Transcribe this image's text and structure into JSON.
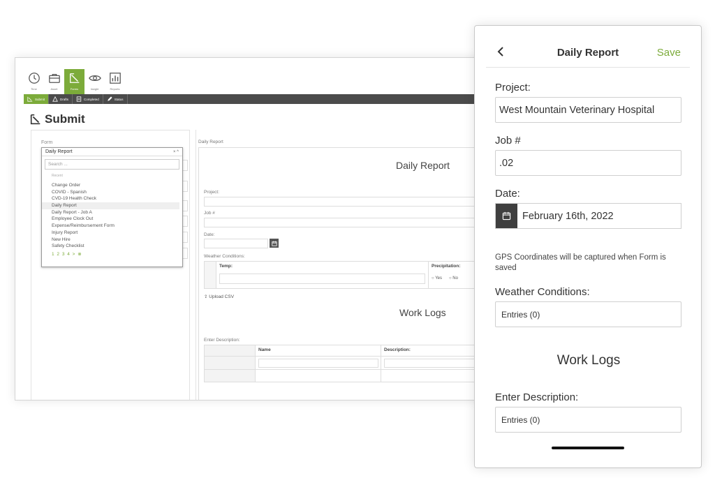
{
  "desktop": {
    "toolbar": [
      {
        "label": "Time",
        "icon": "clock-icon",
        "active": false
      },
      {
        "label": "Asset",
        "icon": "briefcase-icon",
        "active": false
      },
      {
        "label": "Forms",
        "icon": "form-icon",
        "active": true
      },
      {
        "label": "Insight",
        "icon": "eye-icon",
        "active": false
      },
      {
        "label": "Reports",
        "icon": "report-icon",
        "active": false
      }
    ],
    "subtabs": [
      {
        "label": "Submit",
        "icon": "submit-icon",
        "active": true
      },
      {
        "label": "Drafts",
        "icon": "warning-icon",
        "active": false
      },
      {
        "label": "Completed",
        "icon": "list-icon",
        "active": false
      },
      {
        "label": "Status",
        "icon": "pen-icon",
        "active": false
      }
    ],
    "page_title": "Submit",
    "form_label": "Form",
    "dropdown": {
      "selected": "Daily Report",
      "controls": "× ^",
      "search_placeholder": "Search ...",
      "hint": "Recent",
      "items": [
        "Change Order",
        "COVID - Spanish",
        "CVD-19 Health Check",
        "Daily Report",
        "Daily Report - Job A",
        "Employee Clock Out",
        "Expense/Reimbursement Form",
        "Injury Report",
        "New Hire",
        "Safety Checklist"
      ],
      "selected_index": 3,
      "pager": "1 2 3 4 > ⊗"
    },
    "form": {
      "breadcrumb": "Daily Report",
      "heading": "Daily Report",
      "project_label": "Project:",
      "job_label": "Job #",
      "date_label": "Date:",
      "weather_label": "Weather Conditions:",
      "temp_header": "Temp:",
      "precip_header": "Precipitation:",
      "yes_label": "Yes",
      "no_label": "No",
      "upload_label": "Upload CSV",
      "work_logs_heading": "Work Logs",
      "enter_desc_label": "Enter Description:",
      "name_header": "Name",
      "desc_header": "Description:"
    }
  },
  "phone": {
    "title": "Daily Report",
    "save_label": "Save",
    "project_label": "Project:",
    "project_value": "West Mountain Veterinary Hospital",
    "job_label": "Job #",
    "job_value": ".02",
    "date_label": "Date:",
    "date_value": "February 16th, 2022",
    "gps_note": "GPS Coordinates will be captured when Form is saved",
    "weather_label": "Weather Conditions:",
    "weather_value": "Entries (0)",
    "work_logs_heading": "Work Logs",
    "desc_label": "Enter Description:",
    "desc_value": "Entries (0)"
  },
  "colors": {
    "accent": "#7cab3a",
    "dark_bar": "#4b4b4b",
    "date_icon_bg": "#3f3f3f"
  }
}
